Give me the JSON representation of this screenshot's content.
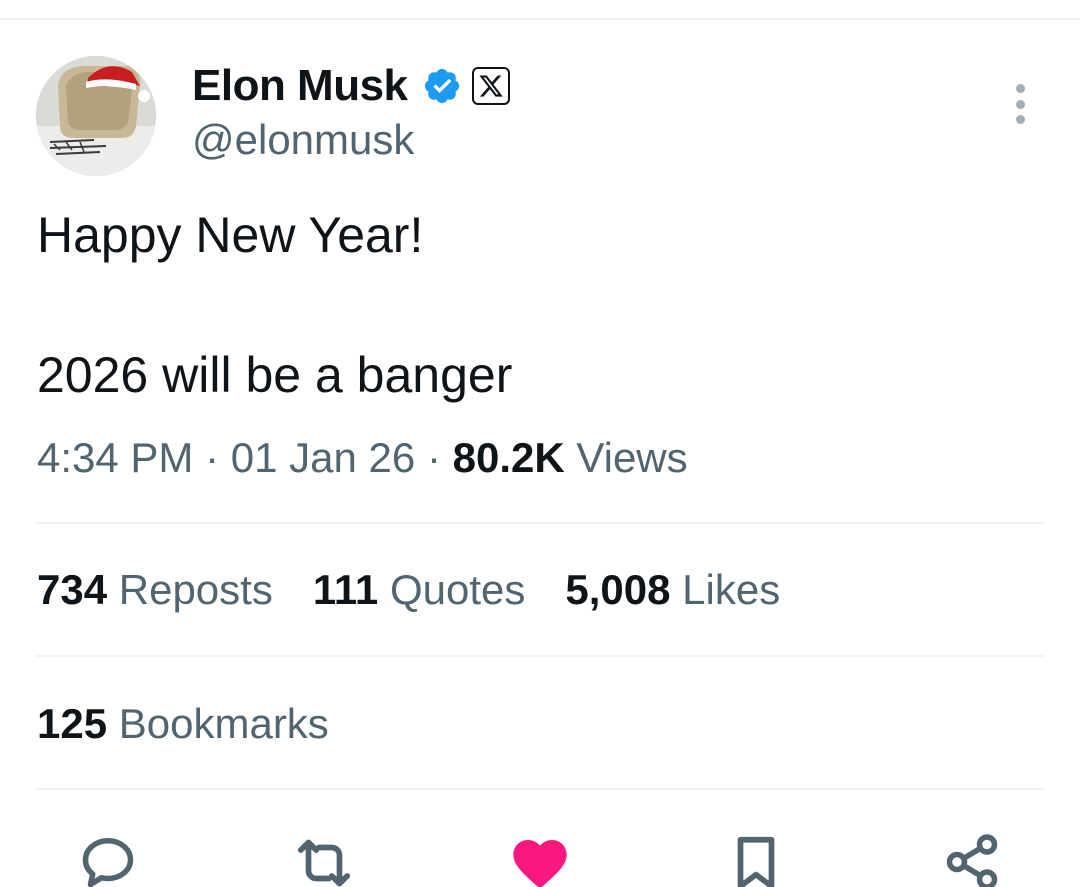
{
  "author": {
    "display_name": "Elon Musk",
    "handle": "@elonmusk",
    "verified_icon": "verified-badge-icon",
    "affiliate_icon": "x-logo-icon",
    "verified_color": "#1d9bf0"
  },
  "tweet": {
    "line1": "Happy New Year!",
    "line2": "2026 will be a banger"
  },
  "meta": {
    "time": "4:34 PM",
    "separator": "·",
    "date": "01 Jan 26",
    "views_count": "80.2K",
    "views_label": "Views"
  },
  "stats": {
    "reposts_count": "734",
    "reposts_label": "Reposts",
    "quotes_count": "111",
    "quotes_label": "Quotes",
    "likes_count": "5,008",
    "likes_label": "Likes",
    "bookmarks_count": "125",
    "bookmarks_label": "Bookmarks"
  },
  "actions": {
    "reply_icon": "reply-icon",
    "repost_icon": "repost-icon",
    "like_icon": "heart-icon",
    "bookmark_icon": "bookmark-icon",
    "share_icon": "share-icon",
    "like_color": "#f91880",
    "icon_color": "#536471"
  }
}
